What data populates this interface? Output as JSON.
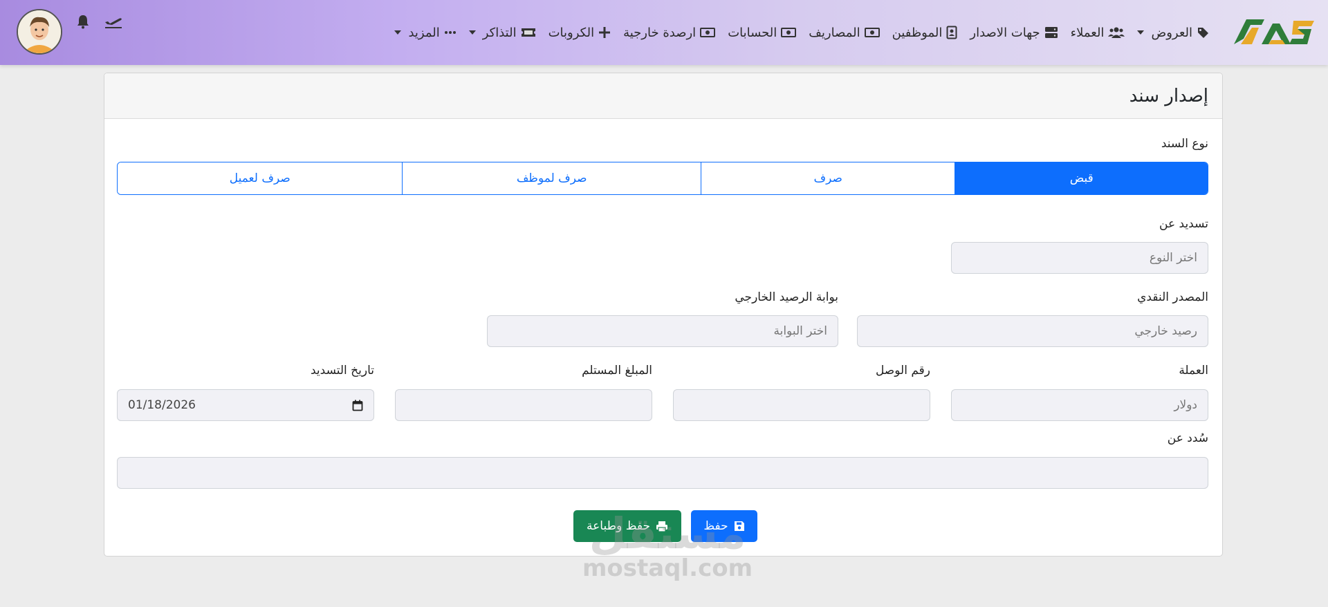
{
  "nav": {
    "items": [
      {
        "label": "العروض",
        "icon": "tags-icon",
        "dropdown": true
      },
      {
        "label": "العملاء",
        "icon": "users-icon",
        "dropdown": false
      },
      {
        "label": "جهات الاصدار",
        "icon": "server-icon",
        "dropdown": false
      },
      {
        "label": "الموظفين",
        "icon": "id-card-icon",
        "dropdown": false
      },
      {
        "label": "المصاريف",
        "icon": "money-bill-icon",
        "dropdown": false
      },
      {
        "label": "الحسابات",
        "icon": "money-bill-icon",
        "dropdown": false
      },
      {
        "label": "ارصدة خارجية",
        "icon": "money-bill-icon",
        "dropdown": false
      },
      {
        "label": "الكروبات",
        "icon": "plus-icon",
        "dropdown": false
      },
      {
        "label": "التذاكر",
        "icon": "ticket-icon",
        "dropdown": true
      },
      {
        "label": "المزيد",
        "icon": "ellipsis-icon",
        "dropdown": true
      }
    ]
  },
  "card": {
    "title": "إصدار سند"
  },
  "form": {
    "voucher_type_label": "نوع السند",
    "voucher_types": [
      "قبض",
      "صرف",
      "صرف لموظف",
      "صرف لعميل"
    ],
    "active_type": "قبض",
    "payment_for_label": "تسديد عن",
    "payment_for_placeholder": "اختر النوع",
    "cash_source_label": "المصدر النقدي",
    "cash_source_value": "رصيد خارجي",
    "gateway_label": "بوابة الرصيد الخارجي",
    "gateway_placeholder": "اختر البوابة",
    "currency_label": "العملة",
    "currency_value": "دولار",
    "receipt_label": "رقم الوصل",
    "receipt_value": "",
    "amount_label": "المبلغ المستلم",
    "amount_value": "",
    "date_label": "تاريخ التسديد",
    "date_value": "01/18/2026",
    "paid_for_label": "سُدد عن",
    "paid_for_value": ""
  },
  "buttons": {
    "save": "حفظ",
    "save_print": "حفظ وطباعة"
  },
  "watermark": {
    "ar": "مستقل",
    "en": "mostaql.com"
  },
  "colors": {
    "primary": "#0d6efd",
    "success": "#198754",
    "nav_gradient_start": "#e6e1f3",
    "nav_gradient_end": "#a88be0"
  }
}
